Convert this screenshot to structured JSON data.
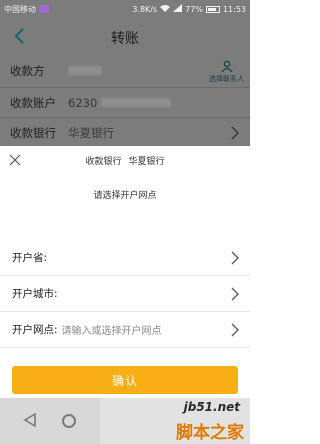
{
  "status_bar": {
    "carrier": "中国移动",
    "speed": "3.8K/s",
    "battery": "77%",
    "time": "11:53"
  },
  "navbar": {
    "title": "转账"
  },
  "form": {
    "payee_label": "收款方",
    "select_contact_label": "选择联系人",
    "account_label": "收款账户",
    "account_value": "6230",
    "bank_label": "收款银行",
    "bank_value": "华夏银行"
  },
  "sheet": {
    "bank_label": "收款银行",
    "bank_value": "华夏银行",
    "prompt": "请选择开户网点",
    "province_label": "开户省:",
    "city_label": "开户城市:",
    "branch_label": "开户网点:",
    "branch_placeholder": "请输入或选择开户网点",
    "confirm_label": "确认"
  },
  "watermark": {
    "url": "jb51.net",
    "text": "脚本之家"
  }
}
